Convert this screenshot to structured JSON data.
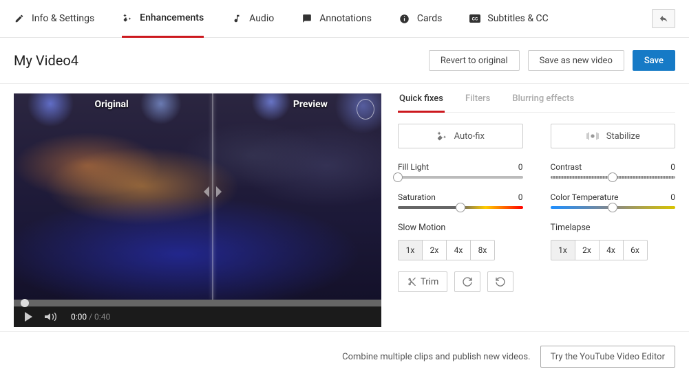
{
  "tabs": {
    "info": "Info & Settings",
    "enhance": "Enhancements",
    "audio": "Audio",
    "annot": "Annotations",
    "cards": "Cards",
    "cc": "Subtitles & CC"
  },
  "title": "My Video4",
  "header_buttons": {
    "revert": "Revert to original",
    "save_new": "Save as new video",
    "save": "Save"
  },
  "player": {
    "label_original": "Original",
    "label_preview": "Preview",
    "time_current": "0:00",
    "time_total": "0:40"
  },
  "sub_tabs": {
    "quick": "Quick fixes",
    "filters": "Filters",
    "blur": "Blurring effects"
  },
  "buttons": {
    "autofix": "Auto-fix",
    "stabilize": "Stabilize",
    "trim": "Trim"
  },
  "sliders": {
    "fill": {
      "label": "Fill Light",
      "value": "0"
    },
    "contrast": {
      "label": "Contrast",
      "value": "0"
    },
    "saturation": {
      "label": "Saturation",
      "value": "0"
    },
    "temp": {
      "label": "Color Temperature",
      "value": "0"
    }
  },
  "slow": {
    "label": "Slow Motion",
    "opts": [
      "1x",
      "2x",
      "4x",
      "8x"
    ],
    "active": "1x"
  },
  "lapse": {
    "label": "Timelapse",
    "opts": [
      "1x",
      "2x",
      "4x",
      "6x"
    ],
    "active": "1x"
  },
  "footer": {
    "text": "Combine multiple clips and publish new videos.",
    "button": "Try the YouTube Video Editor"
  }
}
